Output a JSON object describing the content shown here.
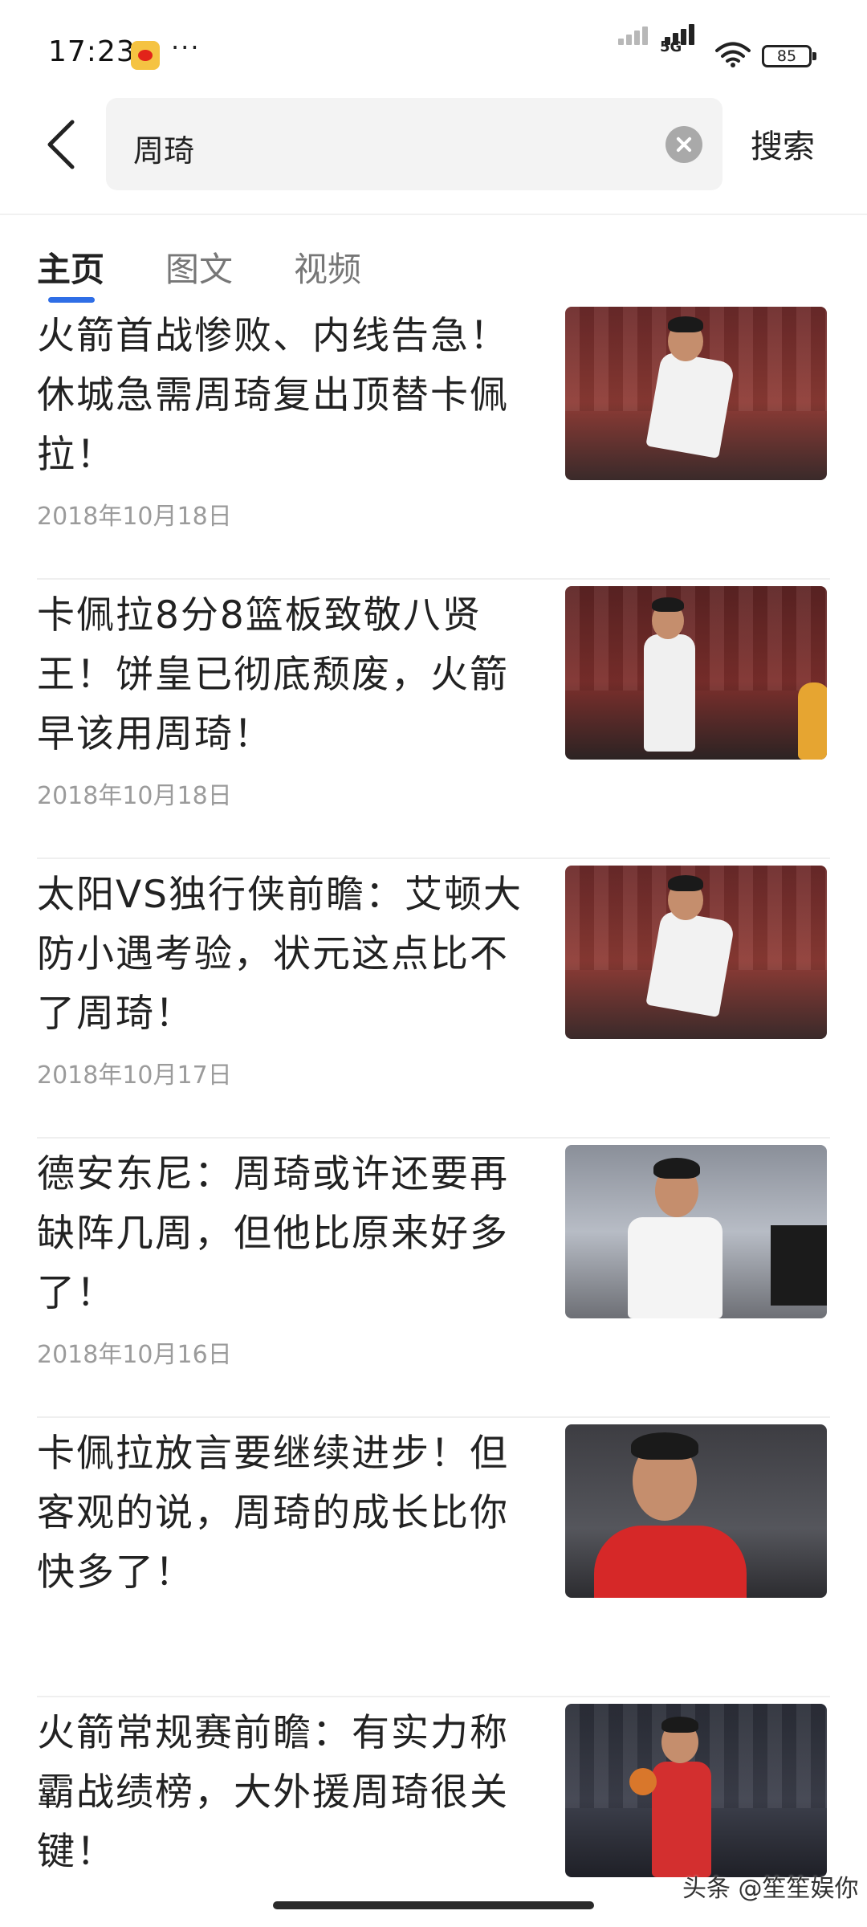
{
  "status_bar": {
    "time": "17:23",
    "network": "5G",
    "battery": "85",
    "icons": [
      "weibo-app-icon",
      "more-dots-icon",
      "signal-icon",
      "wifi-icon",
      "battery-icon"
    ]
  },
  "search": {
    "query": "周琦",
    "submit_label": "搜索",
    "icons": [
      "back-arrow-icon",
      "clear-icon"
    ]
  },
  "tabs": [
    {
      "label": "主页",
      "active": true
    },
    {
      "label": "图文",
      "active": false
    },
    {
      "label": "视频",
      "active": false
    }
  ],
  "articles": [
    {
      "title": "火箭首战惨败、内线告急！休城急需周琦复出顶替卡佩拉！",
      "date": "2018年10月18日",
      "thumbnail": "rockets-player-white-jersey"
    },
    {
      "title": "卡佩拉8分8篮板致敬八贤王！饼皇已彻底颓废，火箭早该用周琦！",
      "date": "2018年10月18日",
      "thumbnail": "rockets-player-white-jersey"
    },
    {
      "title": "太阳VS独行侠前瞻：艾顿大防小遇考验，状元这点比不了周琦！",
      "date": "2018年10月17日",
      "thumbnail": "rockets-player-white-jersey"
    },
    {
      "title": "德安东尼：周琦或许还要再缺阵几周，但他比原来好多了！",
      "date": "2018年10月16日",
      "thumbnail": "rockets-player-white-jersey"
    },
    {
      "title": "卡佩拉放言要继续进步！但客观的说，周琦的成长比你快多了！",
      "date": "",
      "thumbnail": "rockets-player-red-shirt"
    },
    {
      "title": "火箭常规赛前瞻：有实力称霸战绩榜，大外援周琦很关键！",
      "date": "",
      "thumbnail": "rockets-player-red-jersey"
    }
  ],
  "watermark": "头条 @笙笙娱你",
  "colors": {
    "accent": "#2f6ee6",
    "date": "#9b9b9b",
    "search_bg": "#f3f3f3"
  }
}
